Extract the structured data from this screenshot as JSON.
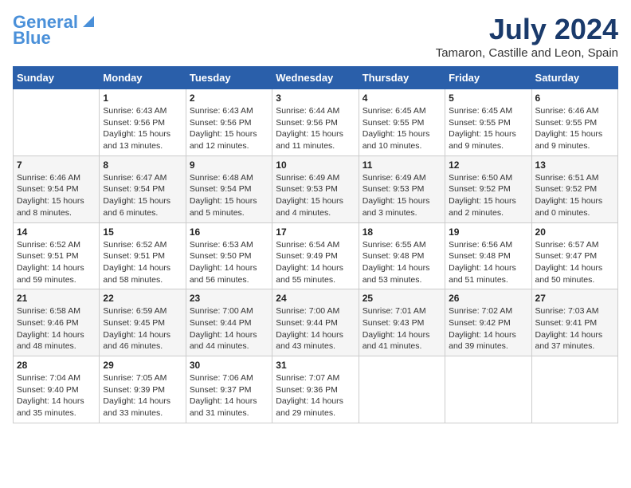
{
  "logo": {
    "line1": "General",
    "line2": "Blue"
  },
  "title": "July 2024",
  "subtitle": "Tamaron, Castille and Leon, Spain",
  "days": [
    "Sunday",
    "Monday",
    "Tuesday",
    "Wednesday",
    "Thursday",
    "Friday",
    "Saturday"
  ],
  "weeks": [
    [
      {
        "num": "",
        "text": ""
      },
      {
        "num": "1",
        "text": "Sunrise: 6:43 AM\nSunset: 9:56 PM\nDaylight: 15 hours and 13 minutes."
      },
      {
        "num": "2",
        "text": "Sunrise: 6:43 AM\nSunset: 9:56 PM\nDaylight: 15 hours and 12 minutes."
      },
      {
        "num": "3",
        "text": "Sunrise: 6:44 AM\nSunset: 9:56 PM\nDaylight: 15 hours and 11 minutes."
      },
      {
        "num": "4",
        "text": "Sunrise: 6:45 AM\nSunset: 9:55 PM\nDaylight: 15 hours and 10 minutes."
      },
      {
        "num": "5",
        "text": "Sunrise: 6:45 AM\nSunset: 9:55 PM\nDaylight: 15 hours and 9 minutes."
      },
      {
        "num": "6",
        "text": "Sunrise: 6:46 AM\nSunset: 9:55 PM\nDaylight: 15 hours and 9 minutes."
      }
    ],
    [
      {
        "num": "7",
        "text": "Sunrise: 6:46 AM\nSunset: 9:54 PM\nDaylight: 15 hours and 8 minutes."
      },
      {
        "num": "8",
        "text": "Sunrise: 6:47 AM\nSunset: 9:54 PM\nDaylight: 15 hours and 6 minutes."
      },
      {
        "num": "9",
        "text": "Sunrise: 6:48 AM\nSunset: 9:54 PM\nDaylight: 15 hours and 5 minutes."
      },
      {
        "num": "10",
        "text": "Sunrise: 6:49 AM\nSunset: 9:53 PM\nDaylight: 15 hours and 4 minutes."
      },
      {
        "num": "11",
        "text": "Sunrise: 6:49 AM\nSunset: 9:53 PM\nDaylight: 15 hours and 3 minutes."
      },
      {
        "num": "12",
        "text": "Sunrise: 6:50 AM\nSunset: 9:52 PM\nDaylight: 15 hours and 2 minutes."
      },
      {
        "num": "13",
        "text": "Sunrise: 6:51 AM\nSunset: 9:52 PM\nDaylight: 15 hours and 0 minutes."
      }
    ],
    [
      {
        "num": "14",
        "text": "Sunrise: 6:52 AM\nSunset: 9:51 PM\nDaylight: 14 hours and 59 minutes."
      },
      {
        "num": "15",
        "text": "Sunrise: 6:52 AM\nSunset: 9:51 PM\nDaylight: 14 hours and 58 minutes."
      },
      {
        "num": "16",
        "text": "Sunrise: 6:53 AM\nSunset: 9:50 PM\nDaylight: 14 hours and 56 minutes."
      },
      {
        "num": "17",
        "text": "Sunrise: 6:54 AM\nSunset: 9:49 PM\nDaylight: 14 hours and 55 minutes."
      },
      {
        "num": "18",
        "text": "Sunrise: 6:55 AM\nSunset: 9:48 PM\nDaylight: 14 hours and 53 minutes."
      },
      {
        "num": "19",
        "text": "Sunrise: 6:56 AM\nSunset: 9:48 PM\nDaylight: 14 hours and 51 minutes."
      },
      {
        "num": "20",
        "text": "Sunrise: 6:57 AM\nSunset: 9:47 PM\nDaylight: 14 hours and 50 minutes."
      }
    ],
    [
      {
        "num": "21",
        "text": "Sunrise: 6:58 AM\nSunset: 9:46 PM\nDaylight: 14 hours and 48 minutes."
      },
      {
        "num": "22",
        "text": "Sunrise: 6:59 AM\nSunset: 9:45 PM\nDaylight: 14 hours and 46 minutes."
      },
      {
        "num": "23",
        "text": "Sunrise: 7:00 AM\nSunset: 9:44 PM\nDaylight: 14 hours and 44 minutes."
      },
      {
        "num": "24",
        "text": "Sunrise: 7:00 AM\nSunset: 9:44 PM\nDaylight: 14 hours and 43 minutes."
      },
      {
        "num": "25",
        "text": "Sunrise: 7:01 AM\nSunset: 9:43 PM\nDaylight: 14 hours and 41 minutes."
      },
      {
        "num": "26",
        "text": "Sunrise: 7:02 AM\nSunset: 9:42 PM\nDaylight: 14 hours and 39 minutes."
      },
      {
        "num": "27",
        "text": "Sunrise: 7:03 AM\nSunset: 9:41 PM\nDaylight: 14 hours and 37 minutes."
      }
    ],
    [
      {
        "num": "28",
        "text": "Sunrise: 7:04 AM\nSunset: 9:40 PM\nDaylight: 14 hours and 35 minutes."
      },
      {
        "num": "29",
        "text": "Sunrise: 7:05 AM\nSunset: 9:39 PM\nDaylight: 14 hours and 33 minutes."
      },
      {
        "num": "30",
        "text": "Sunrise: 7:06 AM\nSunset: 9:37 PM\nDaylight: 14 hours and 31 minutes."
      },
      {
        "num": "31",
        "text": "Sunrise: 7:07 AM\nSunset: 9:36 PM\nDaylight: 14 hours and 29 minutes."
      },
      {
        "num": "",
        "text": ""
      },
      {
        "num": "",
        "text": ""
      },
      {
        "num": "",
        "text": ""
      }
    ]
  ]
}
